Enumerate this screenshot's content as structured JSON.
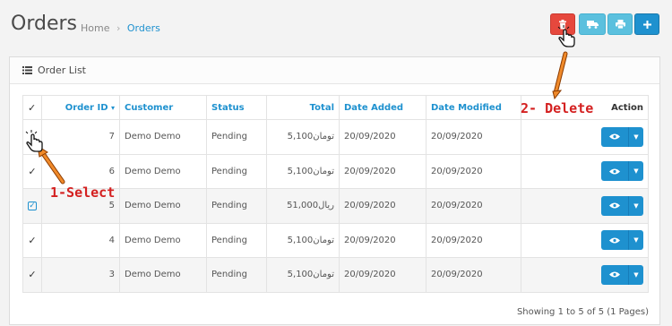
{
  "header": {
    "title": "Orders",
    "breadcrumb": [
      {
        "label": "Home"
      },
      {
        "label": "Orders"
      }
    ],
    "breadcrumb_sep": "›"
  },
  "toolbar": {
    "icons": [
      "trash-icon",
      "truck-icon",
      "print-icon",
      "plus-icon"
    ],
    "colors": {
      "delete": "#e6483d",
      "info": "#5bc0de",
      "primary": "#1e91cf"
    }
  },
  "panel": {
    "title": "Order List"
  },
  "table": {
    "columns": {
      "order_id": "Order ID",
      "customer": "Customer",
      "status": "Status",
      "total": "Total",
      "date_added": "Date Added",
      "date_modified": "Date Modified",
      "action": "Action"
    },
    "rows": [
      {
        "order_id": "7",
        "customer": "Demo Demo",
        "status": "Pending",
        "total": "5,100تومان",
        "date_added": "20/09/2020",
        "date_modified": "20/09/2020",
        "checked": false
      },
      {
        "order_id": "6",
        "customer": "Demo Demo",
        "status": "Pending",
        "total": "5,100تومان",
        "date_added": "20/09/2020",
        "date_modified": "20/09/2020",
        "checked": true
      },
      {
        "order_id": "5",
        "customer": "Demo Demo",
        "status": "Pending",
        "total": "51,000ریال",
        "date_added": "20/09/2020",
        "date_modified": "20/09/2020",
        "checked": true
      },
      {
        "order_id": "4",
        "customer": "Demo Demo",
        "status": "Pending",
        "total": "5,100تومان",
        "date_added": "20/09/2020",
        "date_modified": "20/09/2020",
        "checked": true
      },
      {
        "order_id": "3",
        "customer": "Demo Demo",
        "status": "Pending",
        "total": "5,100تومان",
        "date_added": "20/09/2020",
        "date_modified": "20/09/2020",
        "checked": true
      }
    ]
  },
  "pagination": {
    "info": "Showing 1 to 5 of 5 (1 Pages)"
  },
  "annotations": {
    "select": "1-Select",
    "delete": "2- Delete",
    "color": "#d42020",
    "arrow_color": "#e8701a"
  }
}
